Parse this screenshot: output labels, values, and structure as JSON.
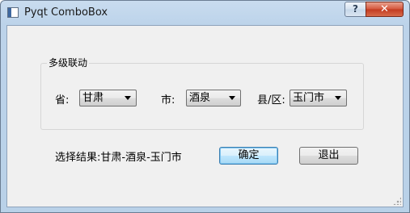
{
  "window": {
    "title": "Pyqt ComboBox",
    "help_label": "?",
    "close_label": "✕"
  },
  "group": {
    "title": "多级联动"
  },
  "province": {
    "label": "省:",
    "selected": "甘肃"
  },
  "city": {
    "label": "市:",
    "selected": "酒泉"
  },
  "county": {
    "label": "县/区:",
    "selected": "玉门市"
  },
  "result": {
    "text": "选择结果:甘肃-酒泉-玉门市"
  },
  "buttons": {
    "ok_label": "确定",
    "exit_label": "退出"
  },
  "icons": {
    "app": "window-app-icon",
    "dropdown": "chevron-down-icon",
    "grip": "size-grip-icon"
  }
}
